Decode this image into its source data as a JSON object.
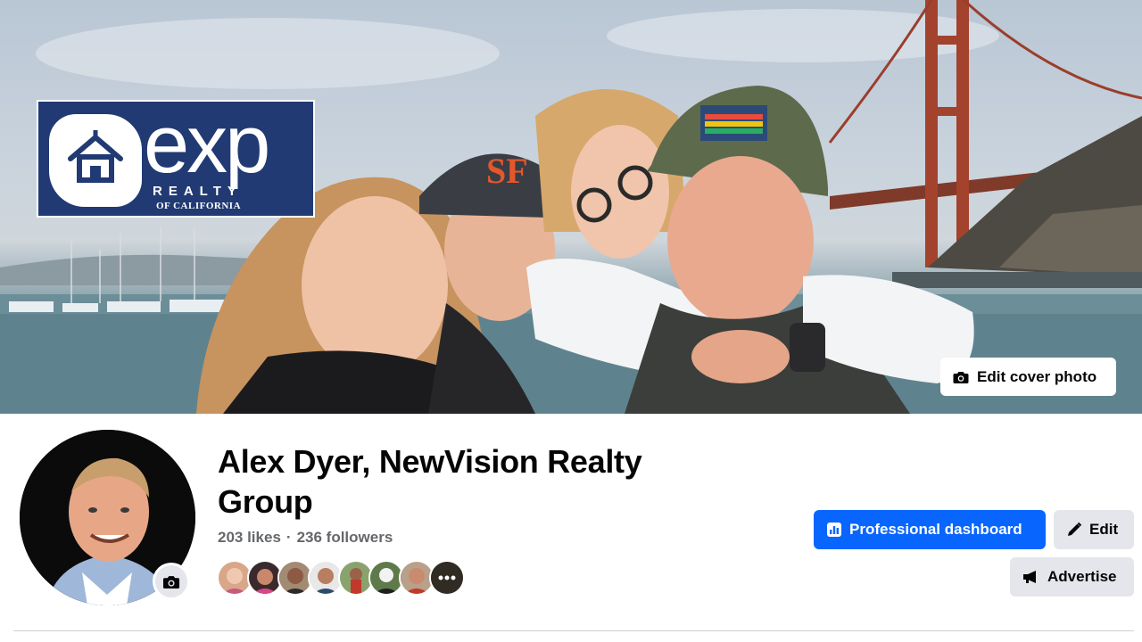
{
  "cover": {
    "logo": {
      "wordmark": "exp",
      "subline": "REALTY",
      "subline2": "OF CALIFORNIA"
    },
    "edit_cover_label": "Edit cover photo"
  },
  "profile": {
    "name": "Alex Dyer, NewVision Realty Group",
    "likes": "203 likes",
    "separator": "·",
    "followers": "236 followers",
    "follower_avatars_count": 8,
    "more_icon": "more-icon"
  },
  "actions": {
    "dashboard_label": "Professional dashboard",
    "edit_label": "Edit",
    "advertise_label": "Advertise"
  },
  "colors": {
    "primary": "#0866ff",
    "secondary_button": "#e4e6eb",
    "muted_text": "#65676b"
  }
}
